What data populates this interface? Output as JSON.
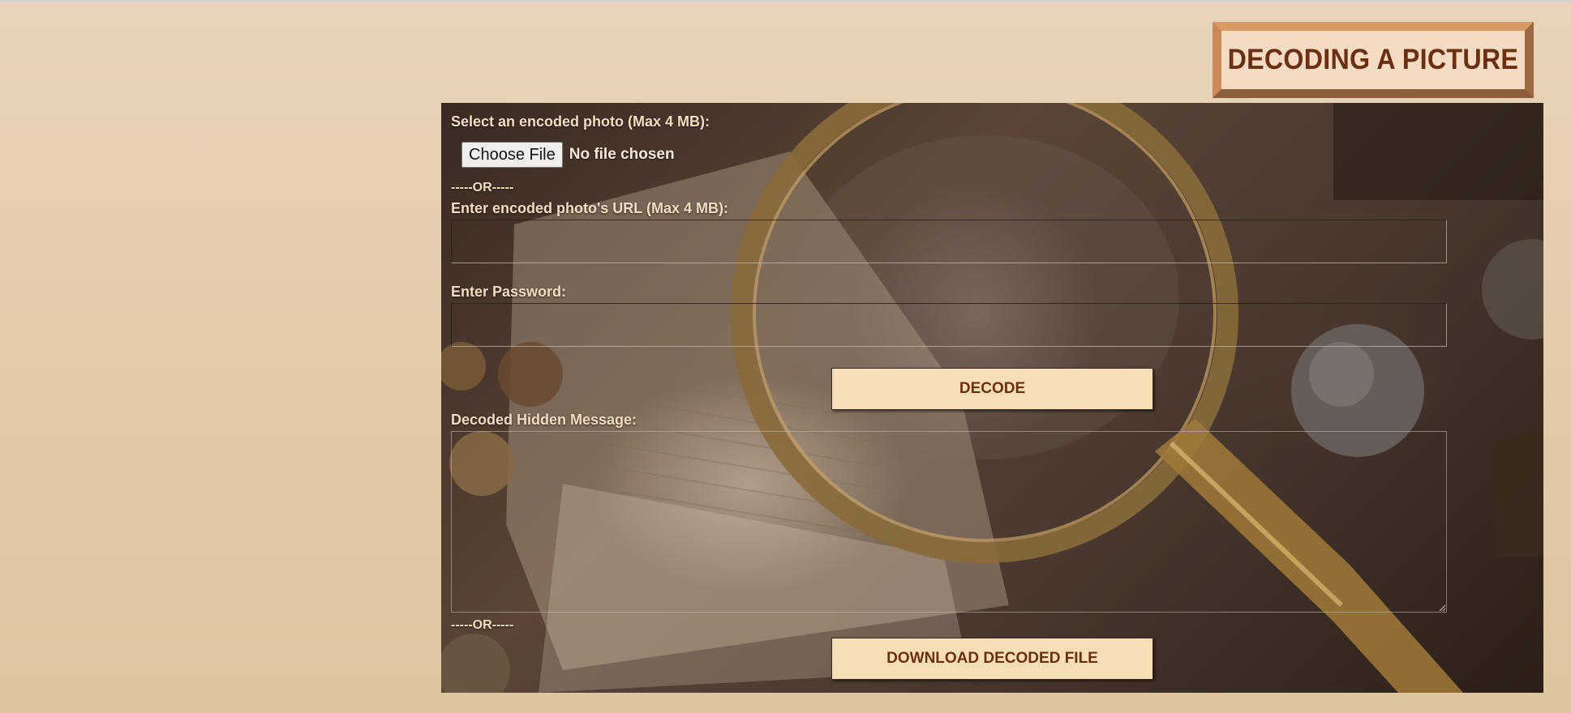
{
  "page": {
    "title": "DECODING A PICTURE"
  },
  "form": {
    "file_label": "Select an encoded photo (Max 4 MB):",
    "choose_file_button": "Choose File",
    "file_status": "No file chosen",
    "or_separator_1": "-----OR-----",
    "url_label": "Enter encoded photo's URL (Max 4 MB):",
    "url_value": "",
    "password_label": "Enter Password:",
    "password_value": "",
    "decode_button": "DECODE",
    "message_label": "Decoded Hidden Message:",
    "message_value": "",
    "or_separator_2": "-----OR-----",
    "download_button": "DOWNLOAD DECODED FILE"
  },
  "colors": {
    "title_text": "#6b2f11",
    "title_bg": "#f4dcc4",
    "title_border": "#c98a57",
    "button_bg": "#f6deb6",
    "label_text": "#f3dcc0"
  },
  "icons": {
    "resize_grip": "resize-grip-icon"
  }
}
